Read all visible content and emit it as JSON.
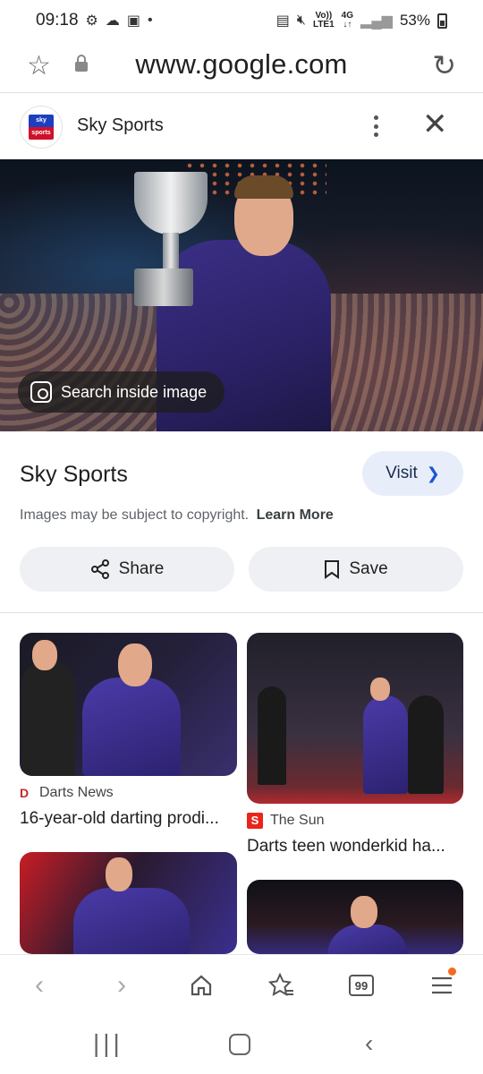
{
  "status_bar": {
    "time": "09:18",
    "network_type": "4G",
    "network_sub": "LTE1",
    "volte": "Vo))",
    "battery": "53%"
  },
  "url_bar": {
    "url": "www.google.com"
  },
  "sheet": {
    "site_name": "Sky Sports",
    "logo_text": "sky sports"
  },
  "hero": {
    "search_inside_label": "Search inside image"
  },
  "info": {
    "source_name": "Sky Sports",
    "visit_label": "Visit",
    "copyright_text": "Images may be subject to copyright.",
    "learn_more": "Learn More",
    "share_label": "Share",
    "save_label": "Save"
  },
  "results": [
    {
      "source": "Darts News",
      "title": "16-year-old darting prodi..."
    },
    {
      "source": "The Sun",
      "title": "Darts teen wonderkid ha..."
    }
  ],
  "toolbar": {
    "tabs_count": "99"
  },
  "colors": {
    "accent": "#1a56d6",
    "visit_bg": "#e8eef9",
    "menu_badge": "#f36b1c"
  },
  "icons": [
    "settings-icon",
    "cloud-icon",
    "lock-icon",
    "star-icon",
    "reload-icon",
    "more-vert-icon",
    "close-icon",
    "lens-icon",
    "chevron-right-icon",
    "share-icon",
    "bookmark-icon",
    "back-icon",
    "forward-icon",
    "home-icon",
    "bookmarks-icon",
    "tabs-icon",
    "menu-icon"
  ]
}
